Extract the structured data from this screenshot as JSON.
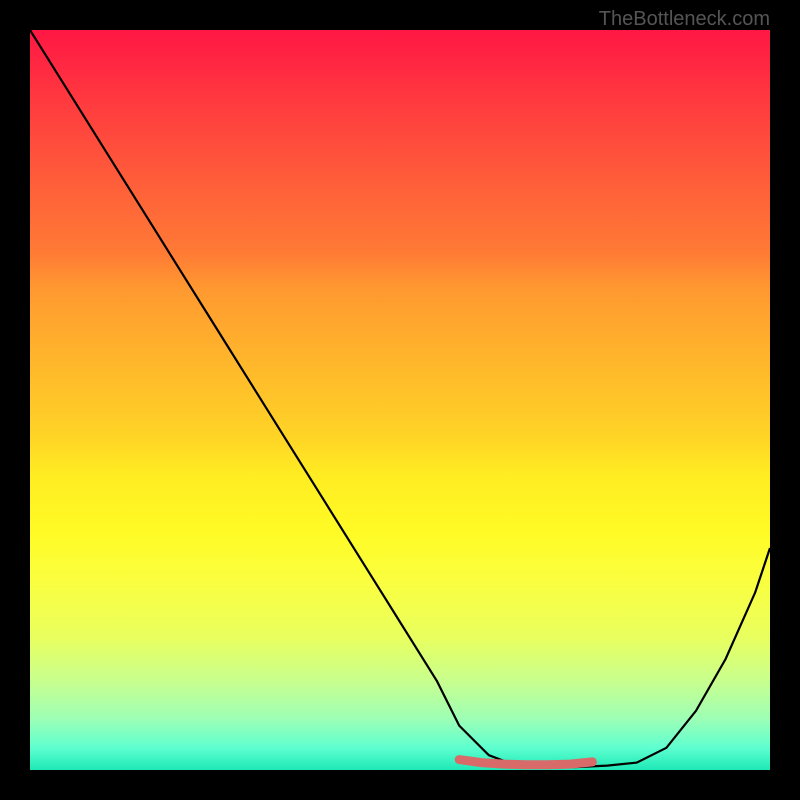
{
  "watermark": "TheBottleneck.com",
  "chart_data": {
    "type": "line",
    "title": "",
    "xlabel": "",
    "ylabel": "",
    "xlim": [
      0,
      100
    ],
    "ylim": [
      0,
      100
    ],
    "series": [
      {
        "name": "bottleneck-curve",
        "x": [
          0,
          5,
          10,
          15,
          20,
          25,
          30,
          35,
          40,
          45,
          50,
          55,
          58,
          62,
          66,
          70,
          74,
          78,
          82,
          86,
          90,
          94,
          98,
          100
        ],
        "values": [
          100,
          92,
          84,
          76,
          68,
          60,
          52,
          44,
          36,
          28,
          20,
          12,
          6,
          2,
          0.5,
          0.3,
          0.4,
          0.6,
          1.0,
          3,
          8,
          15,
          24,
          30
        ]
      }
    ],
    "highlight": {
      "name": "red-flat-segment",
      "color": "#d96a6a",
      "x": [
        58,
        61,
        64,
        67,
        70,
        73,
        76
      ],
      "values": [
        1.4,
        1.0,
        0.8,
        0.7,
        0.7,
        0.8,
        1.1
      ]
    },
    "grid": false,
    "legend": false
  }
}
